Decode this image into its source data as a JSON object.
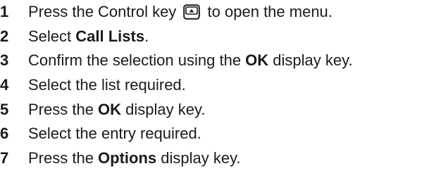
{
  "steps": [
    {
      "num": "1",
      "segments": [
        {
          "type": "text",
          "value": "Press the Control key "
        },
        {
          "type": "icon",
          "icon": "control-key-icon"
        },
        {
          "type": "text",
          "value": " to open the menu."
        }
      ]
    },
    {
      "num": "2",
      "segments": [
        {
          "type": "text",
          "value": "Select "
        },
        {
          "type": "bold",
          "value": "Call Lists"
        },
        {
          "type": "text",
          "value": "."
        }
      ]
    },
    {
      "num": "3",
      "segments": [
        {
          "type": "text",
          "value": "Confirm the selection using the "
        },
        {
          "type": "bold",
          "value": "OK"
        },
        {
          "type": "text",
          "value": " display key."
        }
      ]
    },
    {
      "num": "4",
      "segments": [
        {
          "type": "text",
          "value": "Select the list required."
        }
      ]
    },
    {
      "num": "5",
      "segments": [
        {
          "type": "text",
          "value": "Press the "
        },
        {
          "type": "bold",
          "value": "OK"
        },
        {
          "type": "text",
          "value": " display key."
        }
      ]
    },
    {
      "num": "6",
      "segments": [
        {
          "type": "text",
          "value": "Select the entry required."
        }
      ]
    },
    {
      "num": "7",
      "segments": [
        {
          "type": "text",
          "value": "Press the "
        },
        {
          "type": "bold",
          "value": "Options"
        },
        {
          "type": "text",
          "value": " display key."
        }
      ]
    }
  ]
}
